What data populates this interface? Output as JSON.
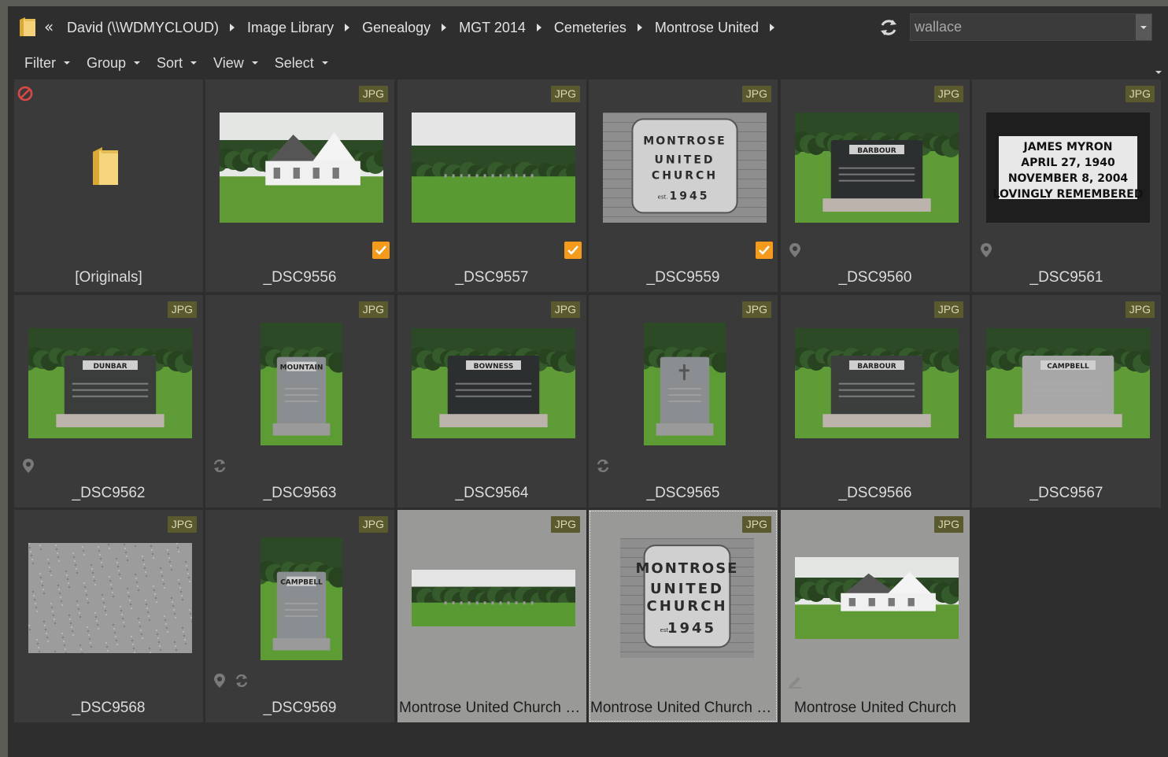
{
  "address": {
    "back_glyph": "«",
    "crumbs": [
      "David (\\\\WDMYCLOUD)",
      "Image Library",
      "Genealogy",
      "MGT 2014",
      "Cemeteries",
      "Montrose United"
    ],
    "search_value": "wallace"
  },
  "toolbar": {
    "filter": "Filter",
    "group": "Group",
    "sort": "Sort",
    "view": "View",
    "select": "Select"
  },
  "badge_text": "JPG",
  "tiles": [
    {
      "name": "[Originals]",
      "type": "folder",
      "status_icon": "no-entry-icon"
    },
    {
      "name": "_DSC9556",
      "thumb": "church-white",
      "checked": true
    },
    {
      "name": "_DSC9557",
      "thumb": "field",
      "checked": true
    },
    {
      "name": "_DSC9559",
      "thumb": "sign-church",
      "checked": true
    },
    {
      "name": "_DSC9560",
      "thumb": "stone-barbour",
      "icons": [
        "location-pin-icon"
      ]
    },
    {
      "name": "_DSC9561",
      "thumb": "plaque-text",
      "icons": [
        "location-pin-icon"
      ],
      "plaque_lines": [
        "JAMES MYRON",
        "APRIL 27, 1940",
        "NOVEMBER 8, 2004",
        "LOVINGLY REMEMBERED"
      ]
    },
    {
      "name": "_DSC9562",
      "thumb": "stone-dunbar",
      "icons": [
        "location-pin-icon"
      ]
    },
    {
      "name": "_DSC9563",
      "thumb": "stone-mountain",
      "icons": [
        "sync-icon"
      ]
    },
    {
      "name": "_DSC9564",
      "thumb": "stone-bowness"
    },
    {
      "name": "_DSC9565",
      "thumb": "stone-cross",
      "icons": [
        "sync-icon"
      ]
    },
    {
      "name": "_DSC9566",
      "thumb": "stone-barbour2"
    },
    {
      "name": "_DSC9567",
      "thumb": "stone-campbell"
    },
    {
      "name": "_DSC9568",
      "thumb": "granite-plate"
    },
    {
      "name": "_DSC9569",
      "thumb": "stone-small",
      "icons": [
        "location-pin-icon",
        "sync-icon"
      ]
    },
    {
      "name": "Montrose United Church c...",
      "thumb": "field-wide",
      "selected": true
    },
    {
      "name": "Montrose United Church s...",
      "thumb": "sign-church-big",
      "selected": true,
      "focused": true
    },
    {
      "name": "Montrose United Church",
      "thumb": "church-white-2",
      "selected": true,
      "icons": [
        "edit-pencil-icon"
      ]
    }
  ],
  "sign_text": {
    "line1": "MONTROSE",
    "line2": "UNITED",
    "line3": "CHURCH",
    "year": "1945",
    "est": "est."
  },
  "stone_labels": {
    "barbour": "BARBOUR",
    "dunbar": "DUNBAR",
    "bowness": "BOWNESS",
    "mountain": "MOUNTAIN",
    "campbell": "CAMPBELL"
  },
  "colors": {
    "accent_check": "#f59a1a",
    "badge_bg": "#5a5a2e",
    "tile_bg": "#3a3a3a",
    "selected_bg": "#999a98"
  }
}
